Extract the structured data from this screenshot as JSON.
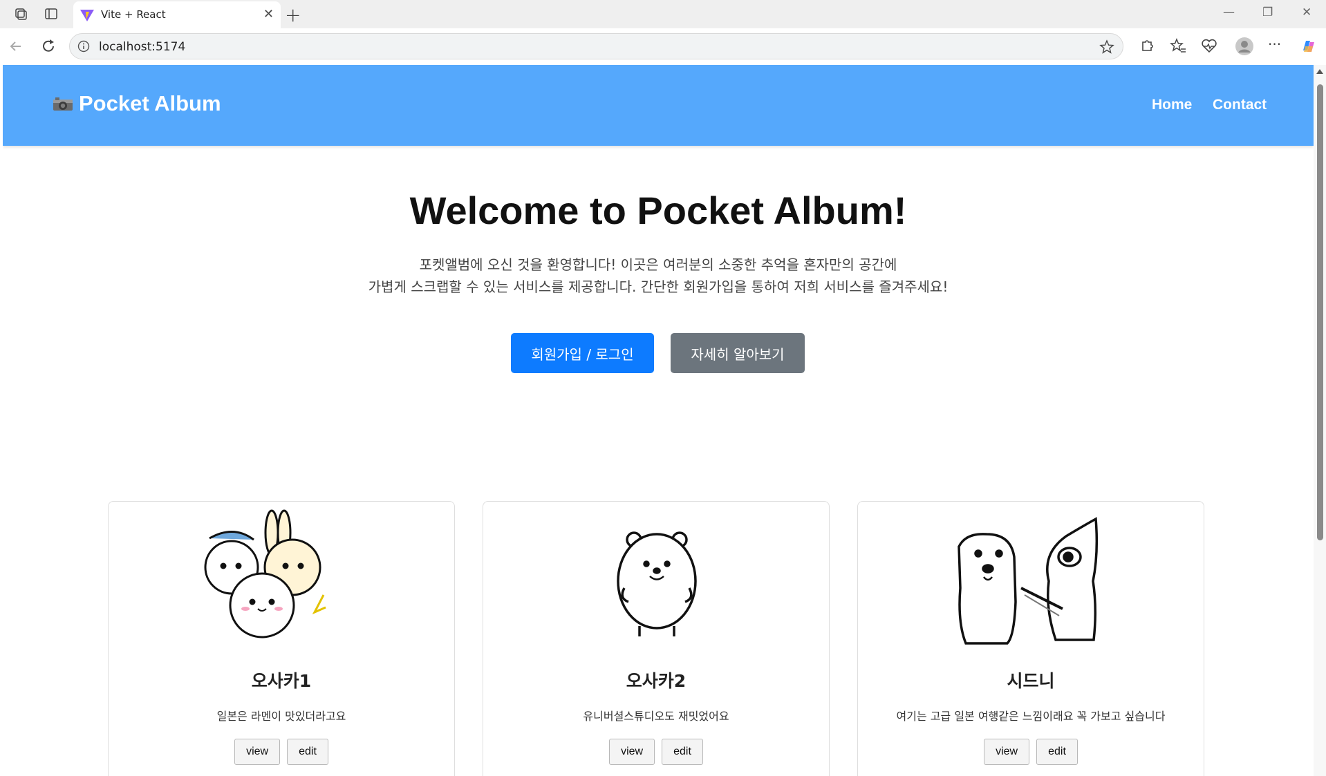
{
  "browser": {
    "tab_title": "Vite + React",
    "url": "localhost:5174"
  },
  "header": {
    "brand_icon": "camera-icon",
    "brand": "Pocket Album",
    "nav": [
      "Home",
      "Contact"
    ],
    "color": "#55a8fc"
  },
  "hero": {
    "title": "Welcome to Pocket Album!",
    "desc_line1": "포켓앨범에 오신 것을 환영합니다! 이곳은 여러분의 소중한 추억을 혼자만의 공간에",
    "desc_line2": "가볍게 스크랩할 수 있는 서비스를 제공합니다. 간단한 회원가입을 통하여 저희 서비스를 즐겨주세요!",
    "primary_button": "회원가입 / 로그인",
    "secondary_button": "자세히 알아보기",
    "primary_color": "#0d7bff",
    "secondary_color": "#6c757d"
  },
  "cards": [
    {
      "title": "오사카1",
      "desc": "일본은 라멘이 맛있더라고요",
      "image": "cartoon-trio-image",
      "view": "view",
      "edit": "edit"
    },
    {
      "title": "오사카2",
      "desc": "유니버셜스튜디오도 재밋었어요",
      "image": "cartoon-bear-image",
      "view": "view",
      "edit": "edit"
    },
    {
      "title": "시드니",
      "desc": "여기는 고급 일본 여행같은 느낌이래요 꼭 가보고 싶습니다",
      "image": "cartoon-dog-image",
      "view": "view",
      "edit": "edit"
    }
  ]
}
